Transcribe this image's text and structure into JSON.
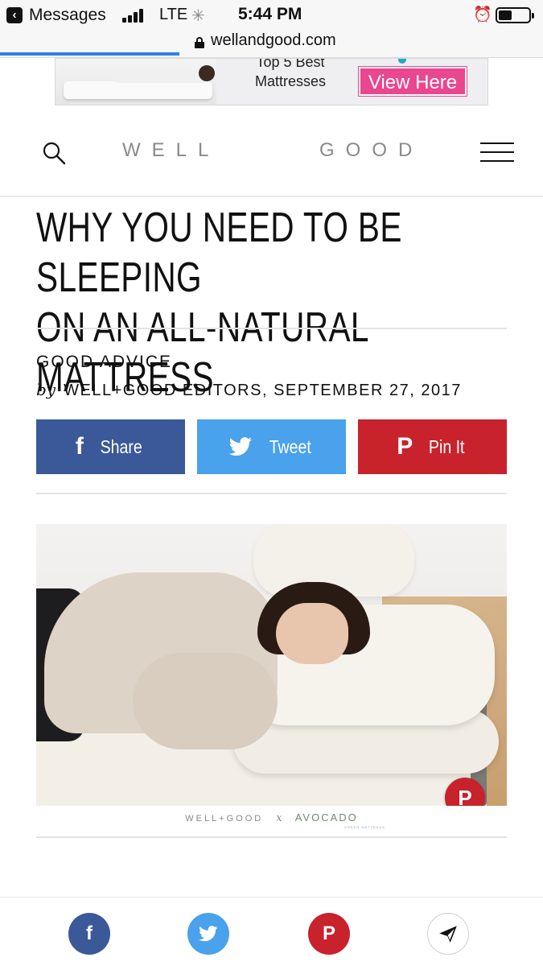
{
  "status_bar": {
    "back_app": "Messages",
    "network": "LTE",
    "time": "5:44 PM",
    "battery_level": 0.45
  },
  "browser": {
    "url": "wellandgood.com",
    "load_progress": 0.33
  },
  "ad": {
    "text_line1": "Top 5 Best",
    "text_line2": "Mattresses",
    "cta": "View Here"
  },
  "site": {
    "logo_left": "WELL",
    "logo_right": "GOOD"
  },
  "article": {
    "title_line1": "WHY YOU NEED TO BE SLEEPING",
    "title_line2": "ON AN ALL-NATURAL MATTRESS",
    "category": "GOOD ADVICE",
    "by_prefix": "by",
    "byline": "WELL+GOOD EDITORS, SEPTEMBER 27, 2017",
    "share_facebook": "Share",
    "share_twitter": "Tweet",
    "share_pinterest": "Pin It",
    "photo_credit_left": "WELL+GOOD",
    "photo_credit_x": "x",
    "photo_credit_brand": "AVOCADO",
    "photo_credit_brand_sub": "GREEN MATTRESS"
  },
  "icons": {
    "facebook": "f",
    "twitter": "twitter-bird-icon",
    "pinterest": "P",
    "send": "paper-plane-icon"
  },
  "colors": {
    "facebook": "#3b5998",
    "twitter": "#4aa1ec",
    "pinterest": "#c8222c",
    "ad_button": "#e9478f",
    "progress": "#2f7ff0"
  }
}
